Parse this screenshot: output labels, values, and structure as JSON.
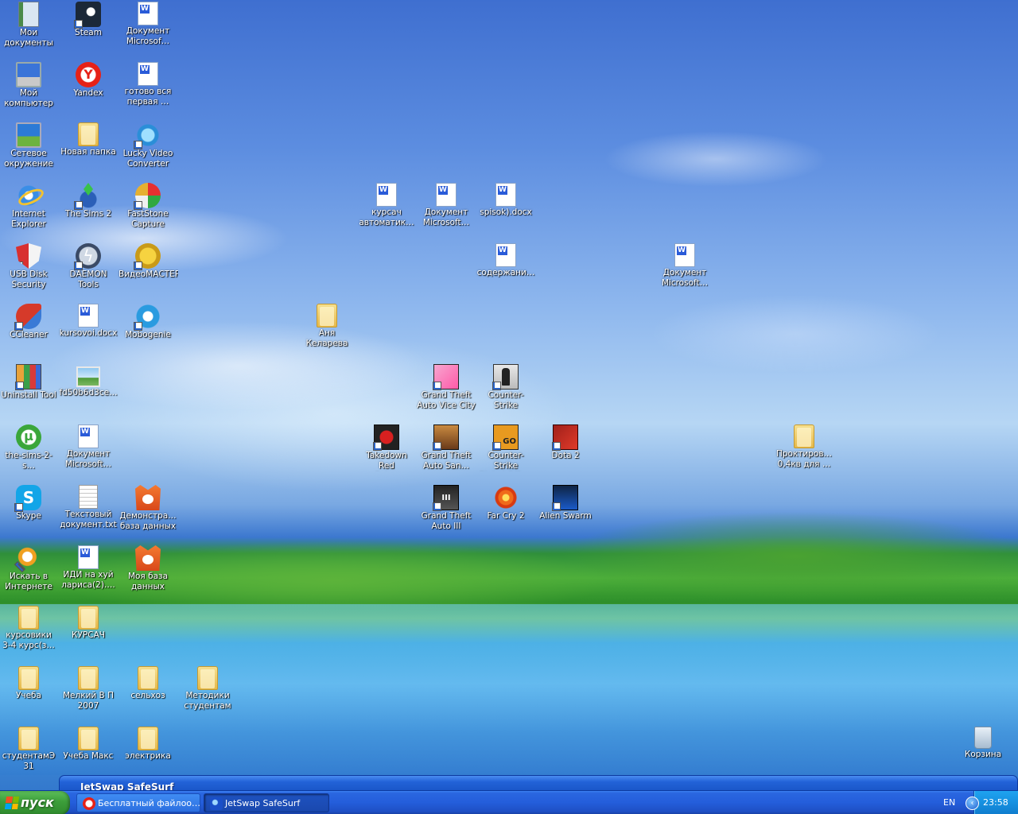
{
  "desktop": {
    "icons": [
      {
        "label": "Мои\nдокументы",
        "icon": "my-documents-icon"
      },
      {
        "label": "Steam",
        "icon": "steam-icon"
      },
      {
        "label": "Документ\nMicrosof…",
        "icon": "word-document-icon"
      },
      {
        "label": "Мой\nкомпьютер",
        "icon": "my-computer-icon"
      },
      {
        "label": "Yandex",
        "icon": "yandex-browser-icon"
      },
      {
        "label": "готово вся\nпервая …",
        "icon": "word-document-icon"
      },
      {
        "label": "Сетевое\nокружение",
        "icon": "network-places-icon"
      },
      {
        "label": "Новая папка",
        "icon": "folder-icon"
      },
      {
        "label": "Lucky Video\nConverter",
        "icon": "lucky-video-converter-icon"
      },
      {
        "label": "Internet\nExplorer",
        "icon": "internet-explorer-icon"
      },
      {
        "label": "The Sims 2",
        "icon": "sims-2-icon"
      },
      {
        "label": "FastStone\nCapture",
        "icon": "faststone-capture-icon"
      },
      {
        "label": "USB Disk\nSecurity",
        "icon": "usb-disk-security-icon"
      },
      {
        "label": "DAEMON Tools",
        "icon": "daemon-tools-icon"
      },
      {
        "label": "ВидеоМАСТЕР",
        "icon": "videomaster-icon"
      },
      {
        "label": "CCleaner",
        "icon": "ccleaner-icon"
      },
      {
        "label": "kursovoi.docx",
        "icon": "word-document-icon"
      },
      {
        "label": "Mobogenie",
        "icon": "mobogenie-icon"
      },
      {
        "label": "Uninstall Tool",
        "icon": "uninstall-tool-icon"
      },
      {
        "label": "fd50b6d3ce…",
        "icon": "image-file-icon"
      },
      {
        "label": "the-sims-2-s…",
        "icon": "utorrent-icon"
      },
      {
        "label": "Документ\nMicrosoft…",
        "icon": "word-document-icon"
      },
      {
        "label": "Skype",
        "icon": "skype-icon"
      },
      {
        "label": "Текстовый\nдокумент.txt",
        "icon": "text-file-icon"
      },
      {
        "label": "Демонстра…\nбаза данных",
        "icon": "access-database-icon"
      },
      {
        "label": "Искать в\nИнтернете",
        "icon": "search-internet-icon"
      },
      {
        "label": "ИДИ на хуй\nлариса(2)….",
        "icon": "word-document-icon"
      },
      {
        "label": "Моя база\nданных",
        "icon": "access-database-icon"
      },
      {
        "label": "курсовики\n3-4 курс(з…",
        "icon": "folder-icon"
      },
      {
        "label": "КУРСАЧ",
        "icon": "folder-icon"
      },
      {
        "label": "Учеба",
        "icon": "folder-icon"
      },
      {
        "label": "Мелкий В П\n2007",
        "icon": "folder-icon"
      },
      {
        "label": "сельхоз",
        "icon": "folder-icon"
      },
      {
        "label": "Методики\nстудентам",
        "icon": "folder-icon"
      },
      {
        "label": "студентамЭ\n31",
        "icon": "folder-icon"
      },
      {
        "label": "Учеба Макс",
        "icon": "folder-icon"
      },
      {
        "label": "электрика",
        "icon": "folder-icon"
      },
      {
        "label": "курсач\nавтоматик…",
        "icon": "word-document-icon"
      },
      {
        "label": "Документ\nMicrosoft…",
        "icon": "word-document-icon"
      },
      {
        "label": "spisok).docx",
        "icon": "word-document-icon"
      },
      {
        "label": "содержани…",
        "icon": "word-document-icon"
      },
      {
        "label": "Документ\nMicrosoft…",
        "icon": "word-document-icon"
      },
      {
        "label": "Аня Келарева",
        "icon": "folder-icon"
      },
      {
        "label": "Grand Theft\nAuto Vice City",
        "icon": "gta-vice-city-icon"
      },
      {
        "label": "Counter-Strike",
        "icon": "counter-strike-icon"
      },
      {
        "label": "Takedown Red\nSabre",
        "icon": "takedown-red-sabre-icon"
      },
      {
        "label": "Grand Theft\nAuto San…",
        "icon": "gta-san-andreas-icon"
      },
      {
        "label": "Counter-Strike\nGlobal Offe…",
        "icon": "csgo-icon"
      },
      {
        "label": "Dota 2",
        "icon": "dota-2-icon"
      },
      {
        "label": "Проктиров…\n0,4кв для …",
        "icon": "folder-icon"
      },
      {
        "label": "Grand Theft\nAuto III",
        "icon": "gta-3-icon"
      },
      {
        "label": "Far Cry 2",
        "icon": "far-cry-2-icon"
      },
      {
        "label": "Alien Swarm",
        "icon": "alien-swarm-icon"
      },
      {
        "label": "Корзина",
        "icon": "recycle-bin-icon"
      }
    ]
  },
  "minimized_window": {
    "title": "JetSwap SafeSurf"
  },
  "taskbar": {
    "start_label": "пуск",
    "tasks": [
      {
        "label": "Бесплатный файлоо…",
        "icon": "yandex-browser-icon"
      },
      {
        "label": "JetSwap SafeSurf",
        "icon": "jetswap-icon"
      }
    ],
    "language": "EN",
    "clock": "23:58"
  },
  "colors": {
    "taskbar_blue": "#245edb",
    "start_green": "#3c9e3a",
    "tray_blue": "#1690e0"
  }
}
